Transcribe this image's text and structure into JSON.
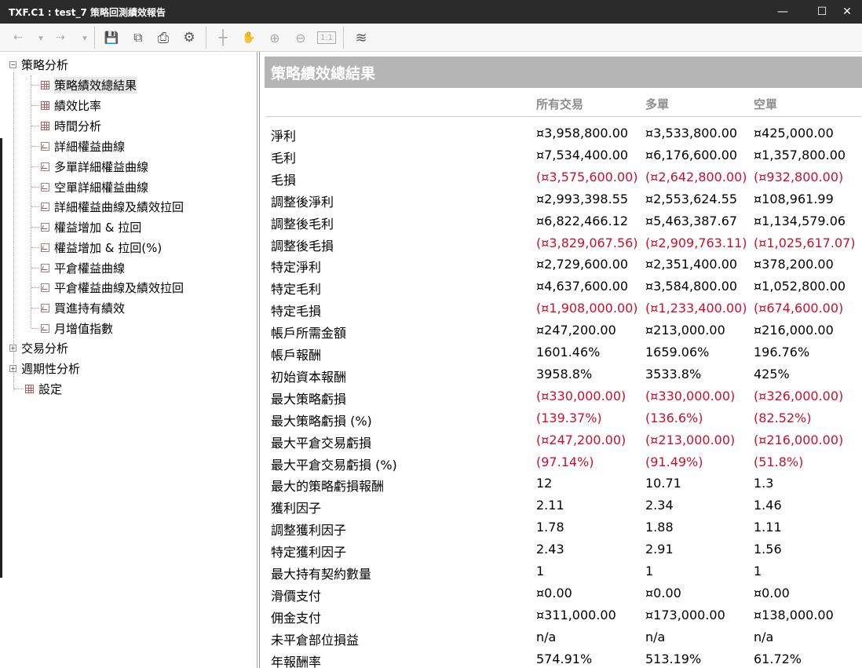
{
  "window": {
    "title": "TXF.C1 : test_7 策略回測績效報告",
    "minimize_glyph": "—",
    "maximize_glyph": "☐",
    "close_glyph": "✕"
  },
  "toolbar": {
    "back_glyph": "⇠",
    "forward_glyph": "⇢",
    "dropdown_glyph": "▾",
    "save_glyph": "💾",
    "copy_glyph": "⧉",
    "print_glyph": "⎙",
    "settings_glyph": "⚙",
    "crosshair_glyph": "┼",
    "hand_glyph": "✋",
    "zoom_in_glyph": "⊕",
    "zoom_out_glyph": "⊖",
    "fit_label": "1:1",
    "chart_glyph": "≋"
  },
  "tree": {
    "expand_open": "−",
    "expand_closed": "+",
    "items": [
      {
        "label": "策略分析"
      },
      {
        "label": "策略績效總結果"
      },
      {
        "label": "績效比率"
      },
      {
        "label": "時間分析"
      },
      {
        "label": "詳細權益曲線"
      },
      {
        "label": "多單詳細權益曲線"
      },
      {
        "label": "空單詳細權益曲線"
      },
      {
        "label": "詳細權益曲線及績效拉回"
      },
      {
        "label": "權益增加 & 拉回"
      },
      {
        "label": "權益增加 & 拉回(%)"
      },
      {
        "label": "平倉權益曲線"
      },
      {
        "label": "平倉權益曲線及績效拉回"
      },
      {
        "label": "買進持有績效"
      },
      {
        "label": "月增值指數"
      },
      {
        "label": "交易分析"
      },
      {
        "label": "週期性分析"
      },
      {
        "label": "設定"
      }
    ]
  },
  "report": {
    "title": "策略績效總結果",
    "columns": [
      "所有交易",
      "多單",
      "空單"
    ],
    "rows": [
      {
        "label": "淨利",
        "values": [
          "¤3,958,800.00",
          "¤3,533,800.00",
          "¤425,000.00"
        ]
      },
      {
        "label": "毛利",
        "values": [
          "¤7,534,400.00",
          "¤6,176,600.00",
          "¤1,357,800.00"
        ]
      },
      {
        "label": "毛損",
        "values": [
          "(¤3,575,600.00)",
          "(¤2,642,800.00)",
          "(¤932,800.00)"
        ]
      },
      {
        "label": "調整後淨利",
        "values": [
          "¤2,993,398.55",
          "¤2,553,624.55",
          "¤108,961.99"
        ]
      },
      {
        "label": "調整後毛利",
        "values": [
          "¤6,822,466.12",
          "¤5,463,387.67",
          "¤1,134,579.06"
        ]
      },
      {
        "label": "調整後毛損",
        "values": [
          "(¤3,829,067.56)",
          "(¤2,909,763.11)",
          "(¤1,025,617.07)"
        ]
      },
      {
        "label": "特定淨利",
        "values": [
          "¤2,729,600.00",
          "¤2,351,400.00",
          "¤378,200.00"
        ]
      },
      {
        "label": "特定毛利",
        "values": [
          "¤4,637,600.00",
          "¤3,584,800.00",
          "¤1,052,800.00"
        ]
      },
      {
        "label": "特定毛損",
        "values": [
          "(¤1,908,000.00)",
          "(¤1,233,400.00)",
          "(¤674,600.00)"
        ]
      },
      {
        "label": "帳戶所需金額",
        "values": [
          "¤247,200.00",
          "¤213,000.00",
          "¤216,000.00"
        ]
      },
      {
        "label": "帳戶報酬",
        "values": [
          "1601.46%",
          "1659.06%",
          "196.76%"
        ]
      },
      {
        "label": "初始資本報酬",
        "values": [
          "3958.8%",
          "3533.8%",
          "425%"
        ]
      },
      {
        "label": "最大策略虧損",
        "values": [
          "(¤330,000.00)",
          "(¤330,000.00)",
          "(¤326,000.00)"
        ]
      },
      {
        "label": "最大策略虧損 (%)",
        "values": [
          "(139.37%)",
          "(136.6%)",
          "(82.52%)"
        ]
      },
      {
        "label": "最大平倉交易虧損",
        "values": [
          "(¤247,200.00)",
          "(¤213,000.00)",
          "(¤216,000.00)"
        ]
      },
      {
        "label": "最大平倉交易虧損 (%)",
        "values": [
          "(97.14%)",
          "(91.49%)",
          "(51.8%)"
        ]
      },
      {
        "label": "最大的策略虧損報酬",
        "values": [
          "12",
          "10.71",
          "1.3"
        ]
      },
      {
        "label": "獲利因子",
        "values": [
          "2.11",
          "2.34",
          "1.46"
        ]
      },
      {
        "label": "調整獲利因子",
        "values": [
          "1.78",
          "1.88",
          "1.11"
        ]
      },
      {
        "label": "特定獲利因子",
        "values": [
          "2.43",
          "2.91",
          "1.56"
        ]
      },
      {
        "label": "最大持有契約數量",
        "values": [
          "1",
          "1",
          "1"
        ]
      },
      {
        "label": "滑價支付",
        "values": [
          "¤0.00",
          "¤0.00",
          "¤0.00"
        ]
      },
      {
        "label": "佣金支付",
        "values": [
          "¤311,000.00",
          "¤173,000.00",
          "¤138,000.00"
        ]
      },
      {
        "label": "未平倉部位損益",
        "values": [
          "n/a",
          "n/a",
          "n/a"
        ]
      },
      {
        "label": "年報酬率",
        "values": [
          "574.91%",
          "513.19%",
          "61.72%"
        ]
      }
    ]
  },
  "colors": {
    "negative": "#c8102e",
    "header_bg": "#b5b5b5",
    "column_header": "#8d8d8d",
    "titlebar_bg": "#2b2b2b"
  }
}
